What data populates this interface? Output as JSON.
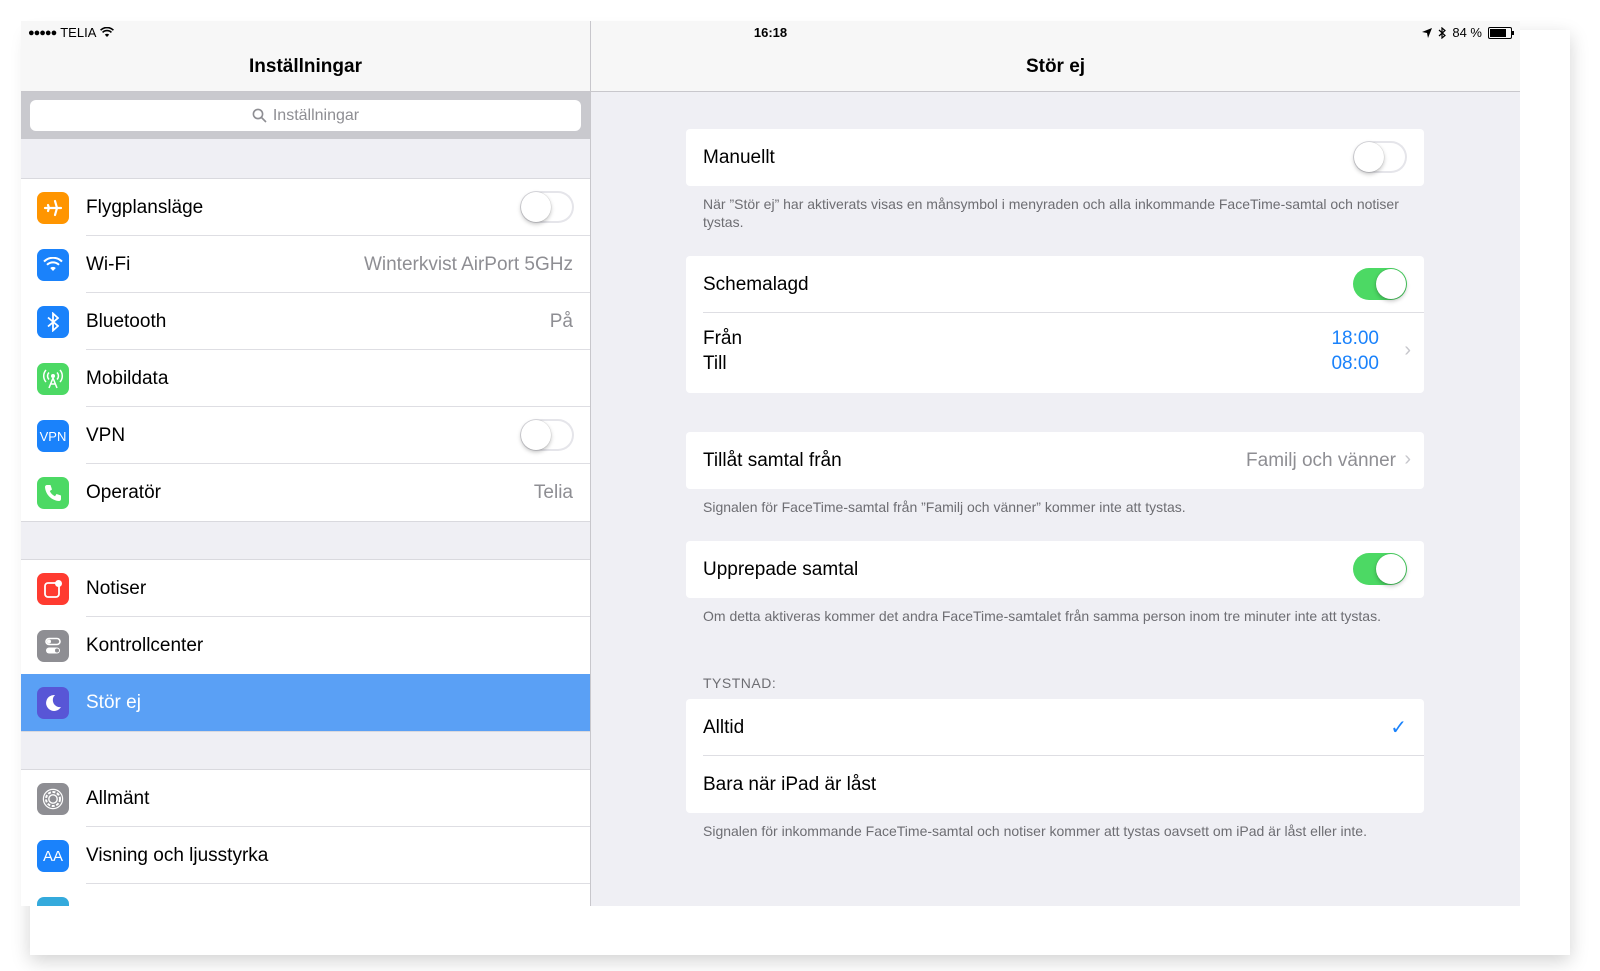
{
  "status_bar": {
    "carrier": "TELIA",
    "time": "16:18",
    "battery": "84 %",
    "signal_dots": "●●●●●"
  },
  "master": {
    "title": "Inställningar",
    "search_placeholder": "Inställningar",
    "group1": [
      {
        "label": "Flygplansläge",
        "icon": "airplane-icon",
        "color": "#ff9500",
        "toggle": false
      },
      {
        "label": "Wi-Fi",
        "icon": "wifi-icon",
        "color": "#1a82fb",
        "value": "Winterkvist AirPort 5GHz"
      },
      {
        "label": "Bluetooth",
        "icon": "bluetooth-icon",
        "color": "#1a82fb",
        "value": "På"
      },
      {
        "label": "Mobildata",
        "icon": "antenna-icon",
        "color": "#4cd964"
      },
      {
        "label": "VPN",
        "icon": "vpn-icon",
        "color": "#1a82fb",
        "icon_text": "VPN",
        "toggle": false
      },
      {
        "label": "Operatör",
        "icon": "phone-icon",
        "color": "#4cd964",
        "value": "Telia"
      }
    ],
    "group2": [
      {
        "label": "Notiser",
        "icon": "notifications-icon",
        "color": "#ff3b30"
      },
      {
        "label": "Kontrollcenter",
        "icon": "control-center-icon",
        "color": "#8e8e93"
      },
      {
        "label": "Stör ej",
        "icon": "moon-icon",
        "color": "#5856d6",
        "selected": true
      }
    ],
    "group3": [
      {
        "label": "Allmänt",
        "icon": "gear-icon",
        "color": "#8e8e93"
      },
      {
        "label": "Visning och ljusstyrka",
        "icon": "display-icon",
        "color": "#1a82fb",
        "icon_text": "AA"
      }
    ]
  },
  "detail": {
    "title": "Stör ej",
    "manual": {
      "label": "Manuellt",
      "toggle": false,
      "footer": "När ”Stör ej” har aktiverats visas en månsymbol i menyraden och alla inkommande FaceTime-samtal och notiser tystas."
    },
    "scheduled": {
      "label": "Schemalagd",
      "toggle": true,
      "from_label": "Från",
      "from_value": "18:00",
      "to_label": "Till",
      "to_value": "08:00"
    },
    "allow_calls": {
      "label": "Tillåt samtal från",
      "value": "Familj och vänner",
      "footer": "Signalen för FaceTime-samtal från ”Familj och vänner” kommer inte att tystas."
    },
    "repeated": {
      "label": "Upprepade samtal",
      "toggle": true,
      "footer": "Om detta aktiveras kommer det andra FaceTime-samtalet från samma person inom tre minuter inte att tystas."
    },
    "silence": {
      "header": "TYSTNAD:",
      "always": "Alltid",
      "locked": "Bara när iPad är låst",
      "footer": "Signalen för inkommande FaceTime-samtal och notiser kommer att tystas oavsett om iPad är låst eller inte."
    }
  },
  "colors": {
    "accent": "#1a82fb",
    "toggle_on": "#4cd964",
    "selected_row": "#5aa0f5"
  }
}
